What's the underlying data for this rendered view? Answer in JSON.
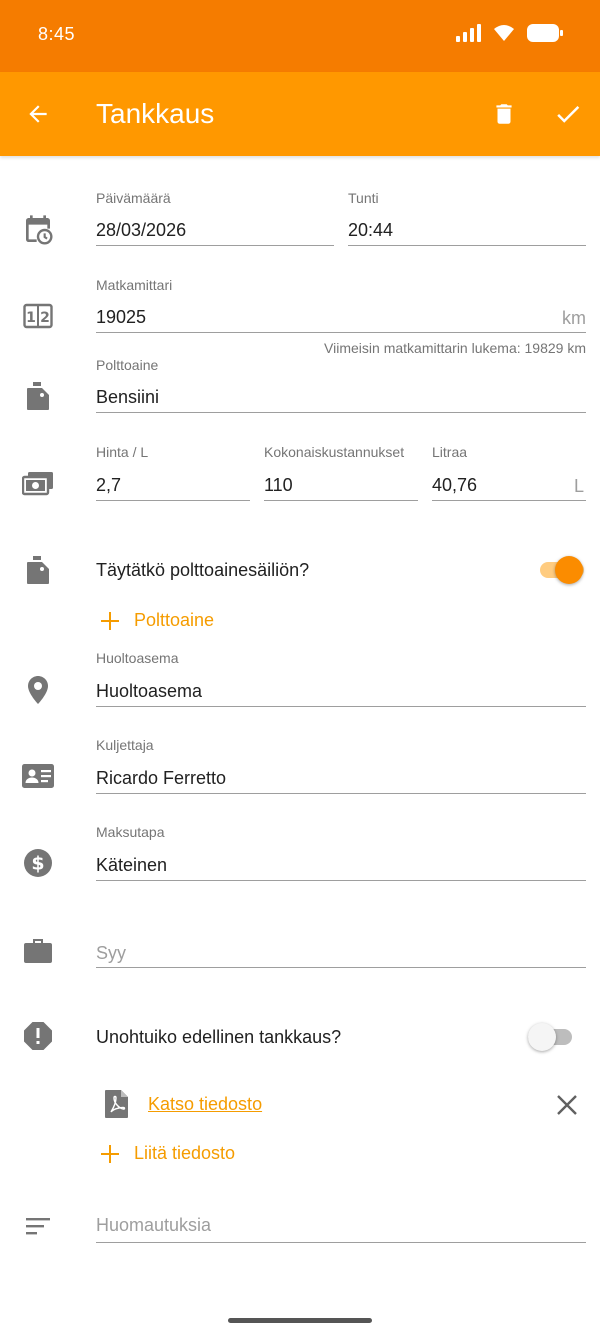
{
  "status_bar": {
    "time": "8:45"
  },
  "app_bar": {
    "title": "Tankkaus"
  },
  "form": {
    "date": {
      "label": "Päivämäärä",
      "value": "28/03/2026"
    },
    "time": {
      "label": "Tunti",
      "value": "20:44"
    },
    "odometer": {
      "label": "Matkamittari",
      "value": "19025",
      "unit": "km",
      "helper": "Viimeisin matkamittarin lukema: 19829 km"
    },
    "fuel": {
      "label": "Polttoaine",
      "value": "Bensiini"
    },
    "price_per_l": {
      "label": "Hinta / L",
      "value": "2,7"
    },
    "total_cost": {
      "label": "Kokonaiskustannukset",
      "value": "110"
    },
    "liters": {
      "label": "Litraa",
      "value": "40,76",
      "unit": "L"
    },
    "full_tank": {
      "label": "Täytätkö polttoainesäiliön?",
      "on": true
    },
    "add_fuel": {
      "label": "Polttoaine"
    },
    "station": {
      "label": "Huoltoasema",
      "value": "Huoltoasema"
    },
    "driver": {
      "label": "Kuljettaja",
      "value": "Ricardo Ferretto"
    },
    "payment": {
      "label": "Maksutapa",
      "value": "Käteinen"
    },
    "reason": {
      "placeholder": "Syy"
    },
    "missed_refuel": {
      "label": "Unohtuiko edellinen tankkaus?",
      "on": false
    },
    "attachment": {
      "link": "Katso tiedosto"
    },
    "attach_file": {
      "label": "Liitä tiedosto"
    },
    "notes": {
      "placeholder": "Huomautuksia"
    }
  },
  "colors": {
    "status_bar": "#F57C00",
    "app_bar": "#FF9800",
    "accent": "#F59C00",
    "icon_grey": "#757575"
  }
}
